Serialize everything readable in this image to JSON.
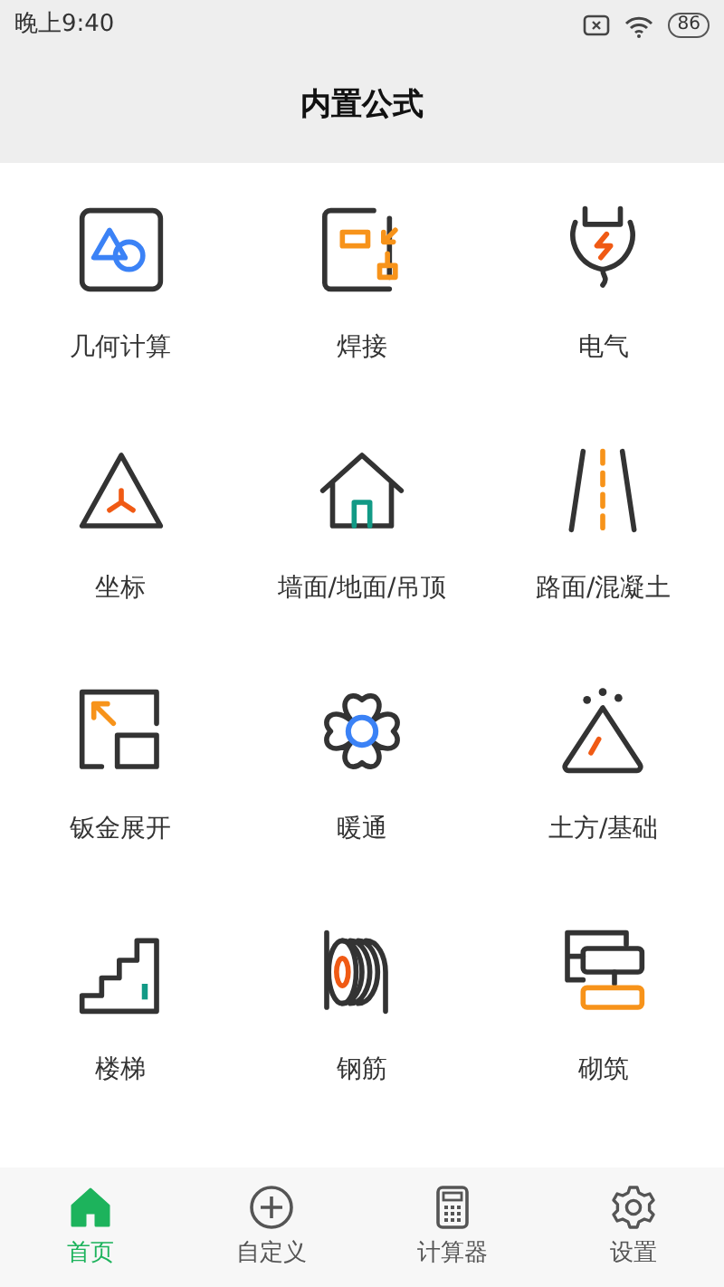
{
  "status_bar": {
    "time": "晚上9:40",
    "battery": "86"
  },
  "header": {
    "title": "内置公式"
  },
  "items": [
    {
      "label": "几何计算",
      "kind": "geometry"
    },
    {
      "label": "焊接",
      "kind": "welding"
    },
    {
      "label": "电气",
      "kind": "electric"
    },
    {
      "label": "坐标",
      "kind": "coordinate"
    },
    {
      "label": "墙面/地面/吊顶",
      "kind": "house"
    },
    {
      "label": "路面/混凝土",
      "kind": "road"
    },
    {
      "label": "钣金展开",
      "kind": "sheetmetal"
    },
    {
      "label": "暖通",
      "kind": "fan"
    },
    {
      "label": "土方/基础",
      "kind": "earth"
    },
    {
      "label": "楼梯",
      "kind": "stairs"
    },
    {
      "label": "钢筋",
      "kind": "rebar"
    },
    {
      "label": "砌筑",
      "kind": "masonry"
    }
  ],
  "bottom_nav": [
    {
      "label": "首页",
      "kind": "home",
      "selected": true
    },
    {
      "label": "自定义",
      "kind": "add",
      "selected": false
    },
    {
      "label": "计算器",
      "kind": "calculator",
      "selected": false
    },
    {
      "label": "设置",
      "kind": "settings",
      "selected": false
    }
  ]
}
